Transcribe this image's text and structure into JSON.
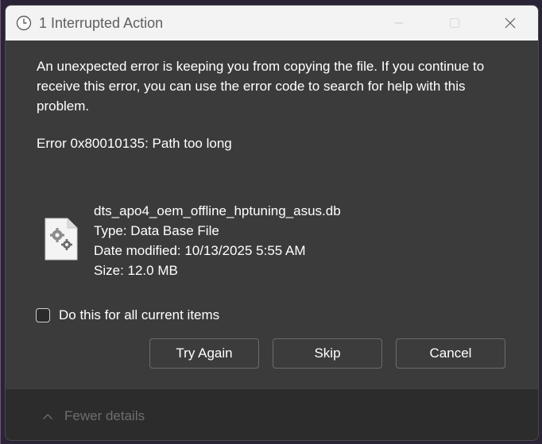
{
  "window": {
    "title": "1 Interrupted Action"
  },
  "dialog": {
    "message": "An unexpected error is keeping you from copying the file. If you continue to receive this error, you can use the error code to search for help with this problem.",
    "error": "Error 0x80010135: Path too long",
    "file": {
      "name": "dts_apo4_oem_offline_hptuning_asus.db",
      "type": "Type: Data Base File",
      "date_modified": "Date modified: 10/13/2025 5:55 AM",
      "size": "Size: 12.0 MB",
      "icon": "settings-file-icon"
    },
    "checkbox_label": "Do this for all current items",
    "checkbox_checked": false,
    "buttons": {
      "try_again": "Try Again",
      "skip": "Skip",
      "cancel": "Cancel"
    },
    "footer": {
      "toggle_label": "Fewer details",
      "icon": "chevron-up-icon"
    }
  },
  "colors": {
    "titlebar_bg": "#f3f3f3",
    "content_bg": "#3b3b3b",
    "footer_bg": "#2c2c2c",
    "button_border": "#6b6b6b",
    "text": "#ffffff",
    "muted_text": "#6e6e6e"
  }
}
